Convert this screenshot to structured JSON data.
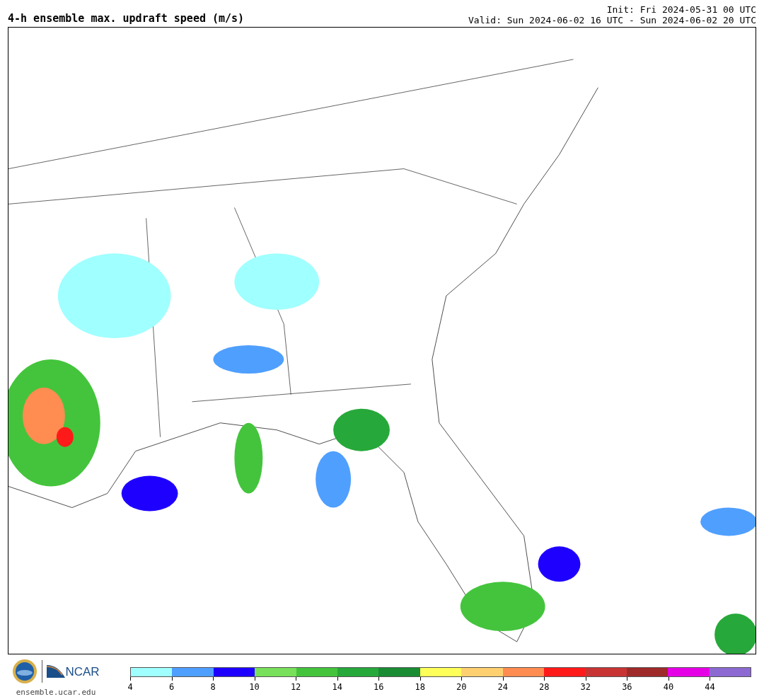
{
  "title": "4-h ensemble max. updraft speed (m/s)",
  "init": "Init: Fri 2024-05-31 00 UTC",
  "valid": "Valid: Sun 2024-06-02 16 UTC - Sun 2024-06-02 20 UTC",
  "footer": {
    "brand": "NCAR",
    "url": "ensemble.ucar.edu"
  },
  "colorbar": {
    "segments": [
      {
        "color": "#a0ffff",
        "label": "4"
      },
      {
        "color": "#4f9fff",
        "label": "6"
      },
      {
        "color": "#1e00ff",
        "label": "8"
      },
      {
        "color": "#78e05a",
        "label": "10"
      },
      {
        "color": "#44c43c",
        "label": "12"
      },
      {
        "color": "#27a83a",
        "label": "14"
      },
      {
        "color": "#1a8c34",
        "label": "16"
      },
      {
        "color": "#ffff5a",
        "label": "18"
      },
      {
        "color": "#ffd070",
        "label": "20"
      },
      {
        "color": "#ff8c50",
        "label": "24"
      },
      {
        "color": "#ff1a1a",
        "label": "28"
      },
      {
        "color": "#c83434",
        "label": "32"
      },
      {
        "color": "#9e2a2a",
        "label": "36"
      },
      {
        "color": "#e600e6",
        "label": "40"
      },
      {
        "color": "#8c6ad2",
        "label": "44"
      }
    ]
  }
}
